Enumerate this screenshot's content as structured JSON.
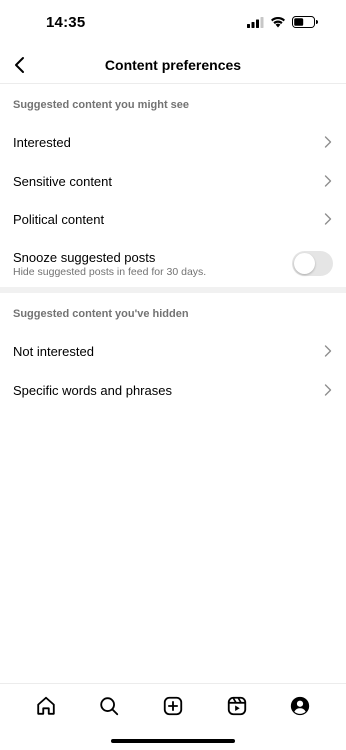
{
  "status_bar": {
    "time": "14:35"
  },
  "nav": {
    "title": "Content preferences"
  },
  "section_suggested": {
    "header": "Suggested content you might see",
    "items": [
      {
        "label": "Interested"
      },
      {
        "label": "Sensitive content"
      },
      {
        "label": "Political content"
      }
    ],
    "snooze": {
      "title": "Snooze suggested posts",
      "subtitle": "Hide suggested posts in feed for 30 days.",
      "enabled": false
    }
  },
  "section_hidden": {
    "header": "Suggested content you've hidden",
    "items": [
      {
        "label": "Not interested"
      },
      {
        "label": "Specific words and phrases"
      }
    ]
  },
  "tab_bar": {
    "tabs": [
      {
        "icon": "home-icon"
      },
      {
        "icon": "search-icon"
      },
      {
        "icon": "create-icon"
      },
      {
        "icon": "reels-icon"
      },
      {
        "icon": "profile-icon"
      }
    ]
  },
  "colors": {
    "secondary_text": "#737373",
    "toggle_off": "#e5e5e5",
    "divider": "#f1f1f1"
  }
}
